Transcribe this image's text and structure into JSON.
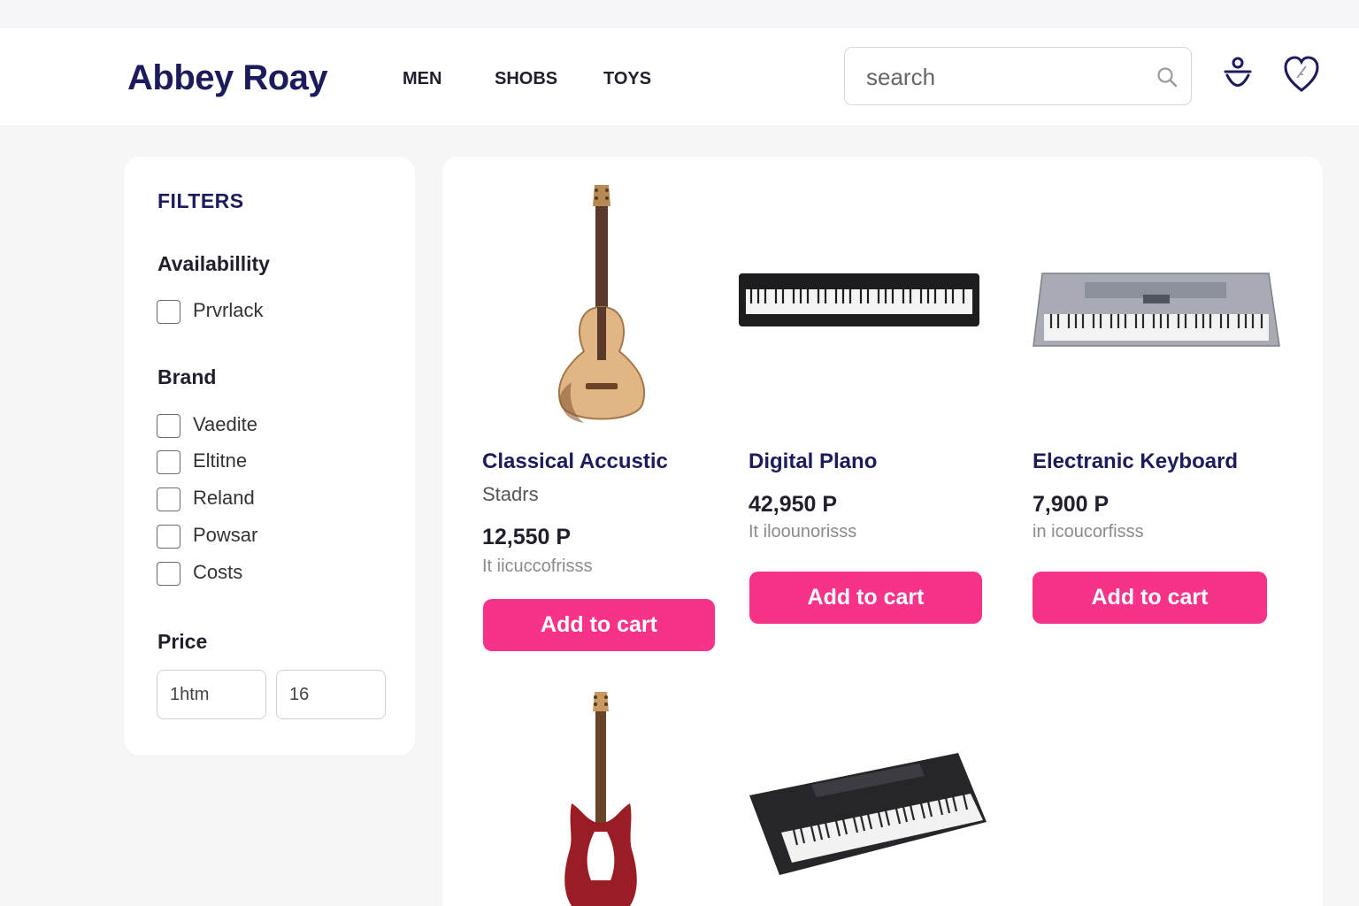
{
  "header": {
    "logo": "Abbey Roay",
    "nav": [
      "MEN",
      "SHOBS",
      "TOYS"
    ],
    "search_placeholder": "search",
    "icons": [
      "search-icon",
      "user-icon",
      "heart-icon"
    ]
  },
  "filters": {
    "title": "FILTERS",
    "availability": {
      "heading": "Availabillity",
      "options": [
        "Prvrlack"
      ]
    },
    "brand": {
      "heading": "Brand",
      "options": [
        "Vaedite",
        "Eltitne",
        "Reland",
        "Powsar",
        "Costs"
      ]
    },
    "price": {
      "heading": "Price",
      "min_value": "1htm",
      "max_value": "16"
    }
  },
  "products": [
    {
      "name": "Classical Accustic",
      "subtitle": "Stadrs",
      "price": "12,550 P",
      "stock": "It iicuccofrisss",
      "button": "Add to cart",
      "image": "acoustic-guitar"
    },
    {
      "name": "Digital Plano",
      "price": "42,950 P",
      "stock": "It iloounorisss",
      "button": "Add to cart",
      "image": "digital-piano"
    },
    {
      "name": "Electranic Keyboard",
      "price": "7,900 P",
      "stock": "in icoucorfisss",
      "button": "Add to cart",
      "image": "electronic-keyboard"
    },
    {
      "image": "electric-guitar"
    },
    {
      "image": "portable-keyboard"
    }
  ],
  "colors": {
    "brand": "#1c1c5c",
    "accent": "#f73389",
    "background": "#f7f7f8"
  }
}
